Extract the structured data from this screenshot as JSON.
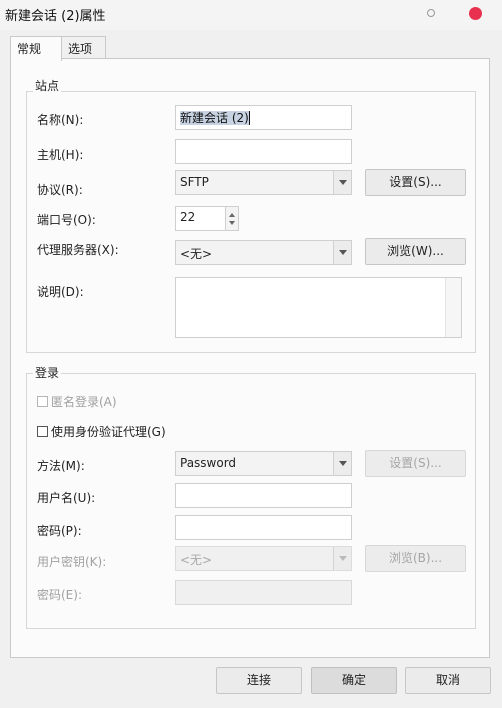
{
  "window": {
    "title": "新建会话 (2)属性"
  },
  "tabs": [
    "常规",
    "选项"
  ],
  "site": {
    "group_title": "站点",
    "name_label": "名称(N):",
    "name_value": "新建会话 (2)",
    "host_label": "主机(H):",
    "host_value": "",
    "protocol_label": "协议(R):",
    "protocol_value": "SFTP",
    "protocol_settings": "设置(S)...",
    "port_label": "端口号(O):",
    "port_value": "22",
    "proxy_label": "代理服务器(X):",
    "proxy_value": "<无>",
    "proxy_browse": "浏览(W)...",
    "desc_label": "说明(D):",
    "desc_value": ""
  },
  "login": {
    "group_title": "登录",
    "anonymous_label": "匿名登录(A)",
    "use_agent_label": "使用身份验证代理(G)",
    "method_label": "方法(M):",
    "method_value": "Password",
    "method_settings": "设置(S)...",
    "user_label": "用户名(U):",
    "user_value": "",
    "password_label": "密码(P):",
    "password_value": "",
    "user_key_label": "用户密钥(K):",
    "user_key_value": "<无>",
    "user_key_browse": "浏览(B)...",
    "passphrase_label": "密码(E):",
    "passphrase_value": ""
  },
  "footer": {
    "connect": "连接",
    "ok": "确定",
    "cancel": "取消"
  },
  "colors": {
    "close_button": "#e8304f",
    "selection": "#c7d3e3"
  }
}
